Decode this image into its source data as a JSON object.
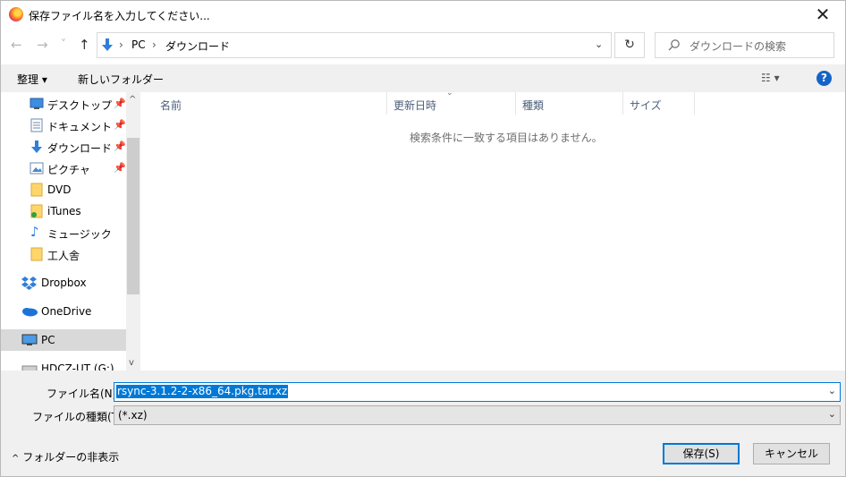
{
  "window": {
    "title": "保存ファイル名を入力してください..."
  },
  "nav": {
    "back": "←",
    "forward": "→",
    "recent": "˅",
    "up": "↑",
    "path": [
      "PC",
      "ダウンロード"
    ],
    "refresh": "↻",
    "search_placeholder": "ダウンロードの検索"
  },
  "toolbar": {
    "organize": "整理",
    "new_folder": "新しいフォルダー"
  },
  "sidebar": {
    "items": [
      {
        "label": "デスクトップ",
        "pinned": true,
        "icon": "desktop-icon"
      },
      {
        "label": "ドキュメント",
        "pinned": true,
        "icon": "document-icon"
      },
      {
        "label": "ダウンロード",
        "pinned": true,
        "icon": "download-icon"
      },
      {
        "label": "ピクチャ",
        "pinned": true,
        "icon": "pictures-icon"
      },
      {
        "label": "DVD",
        "pinned": false,
        "icon": "folder-icon"
      },
      {
        "label": "iTunes",
        "pinned": false,
        "icon": "folder-icon"
      },
      {
        "label": "ミュージック",
        "pinned": false,
        "icon": "music-icon"
      },
      {
        "label": "工人舎",
        "pinned": false,
        "icon": "folder-icon"
      },
      {
        "label": "Dropbox",
        "pinned": false,
        "icon": "dropbox-icon"
      },
      {
        "label": "OneDrive",
        "pinned": false,
        "icon": "onedrive-icon"
      },
      {
        "label": "PC",
        "pinned": false,
        "icon": "pc-icon",
        "selected": true
      },
      {
        "label": "HDCZ-UT (G:)",
        "pinned": false,
        "icon": "drive-icon"
      }
    ]
  },
  "list": {
    "columns": [
      "名前",
      "更新日時",
      "種類",
      "サイズ"
    ],
    "empty_message": "検索条件に一致する項目はありません。"
  },
  "form": {
    "filename_label": "ファイル名(N):",
    "filename_value": "rsync-3.1.2-2-x86_64.pkg.tar.xz",
    "filetype_label": "ファイルの種類(T):",
    "filetype_value": "(*.xz)"
  },
  "footer": {
    "hide_folders": "フォルダーの非表示",
    "save": "保存(S)",
    "cancel": "キャンセル"
  },
  "colors": {
    "accent": "#0078d7",
    "selected_nav": "#d9d9d9",
    "panel": "#f0f0f0"
  }
}
